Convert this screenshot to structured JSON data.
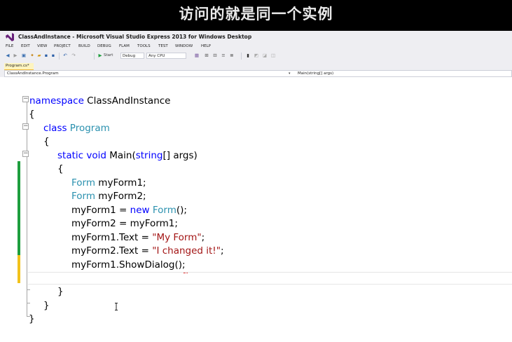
{
  "caption": "访问的就是同一个实例",
  "window": {
    "title": "ClassAndInstance - Microsoft Visual Studio Express 2013 for Windows Desktop"
  },
  "menu": [
    "FILE",
    "EDIT",
    "VIEW",
    "PROJECT",
    "BUILD",
    "DEBUG",
    "FLAM",
    "TOOLS",
    "TEST",
    "WINDOW",
    "HELP"
  ],
  "toolbar": {
    "start_label": "Start",
    "config": "Debug",
    "platform": "Any CPU"
  },
  "tab": {
    "label": "Program.cs*"
  },
  "navbar": {
    "left": "ClassAndInstance.Program",
    "right": "Main(string[] args)"
  },
  "code": {
    "l1_kw": "namespace",
    "l1_name": " ClassAndInstance",
    "l2": "{",
    "l3_kw": "class",
    "l3_type": " Program",
    "l4": "{",
    "l5_kw": "static void",
    "l5_main": " Main(",
    "l5_kw2": "string",
    "l5_rest": "[] args)",
    "l6": "{",
    "l7_type": "Form",
    "l7_rest": " myForm1;",
    "l8_type": "Form",
    "l8_rest": " myForm2;",
    "l9_a": "myForm1 = ",
    "l9_kw": "new",
    "l9_type": " Form",
    "l9_rest": "();",
    "l10": "myForm2 = myForm1;",
    "l11_a": "myForm1.Text = ",
    "l11_str": "\"My Form\"",
    "l11_rest": ";",
    "l12_a": "myForm2.Text = ",
    "l12_str": "\"I changed it!\"",
    "l12_rest": ";",
    "l13": "myForm1.ShowDialog();",
    "l15": "}",
    "l16": "}",
    "l17": "}"
  },
  "colors": {
    "keyword": "#0000ff",
    "type": "#2b91af",
    "string": "#a31515",
    "change_saved": "#1e9e3e",
    "change_unsaved": "#f2c21b"
  }
}
